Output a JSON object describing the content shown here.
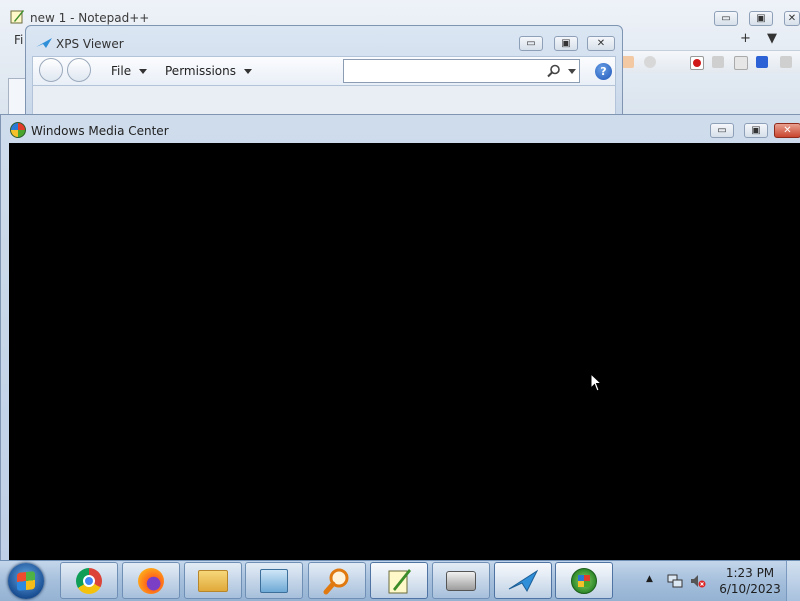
{
  "notepad": {
    "title": "new 1 - Notepad++",
    "menu_partial": "Fi",
    "tab_add": "+",
    "tab_list": "▼",
    "minimize": "▭",
    "maximize": "▣",
    "close": "✕"
  },
  "xps": {
    "title": "XPS Viewer",
    "menu_file": "File",
    "menu_permissions": "Permissions",
    "search_placeholder": "",
    "help": "?",
    "minimize": "▭",
    "maximize": "▣",
    "close": "✕"
  },
  "wmc": {
    "title": "Windows Media Center",
    "minimize": "▭",
    "maximize": "▣",
    "close": "✕"
  },
  "taskbar": {
    "apps": [
      {
        "icon": "chrome-icon"
      },
      {
        "icon": "firefox-icon"
      },
      {
        "icon": "file-explorer-icon"
      },
      {
        "icon": "control-panel-icon"
      },
      {
        "icon": "search-magnifier-icon"
      },
      {
        "icon": "notepad-plus-plus-icon"
      },
      {
        "icon": "fax-scan-icon"
      },
      {
        "icon": "xps-viewer-icon"
      },
      {
        "icon": "media-center-icon"
      }
    ],
    "tray_arrow": "▲",
    "clock_time": "1:23 PM",
    "clock_date": "6/10/2023"
  },
  "colors": {
    "wmc_screen": "#000000",
    "close_red": "#c8452f",
    "taskbar": "#a5bfdc"
  }
}
